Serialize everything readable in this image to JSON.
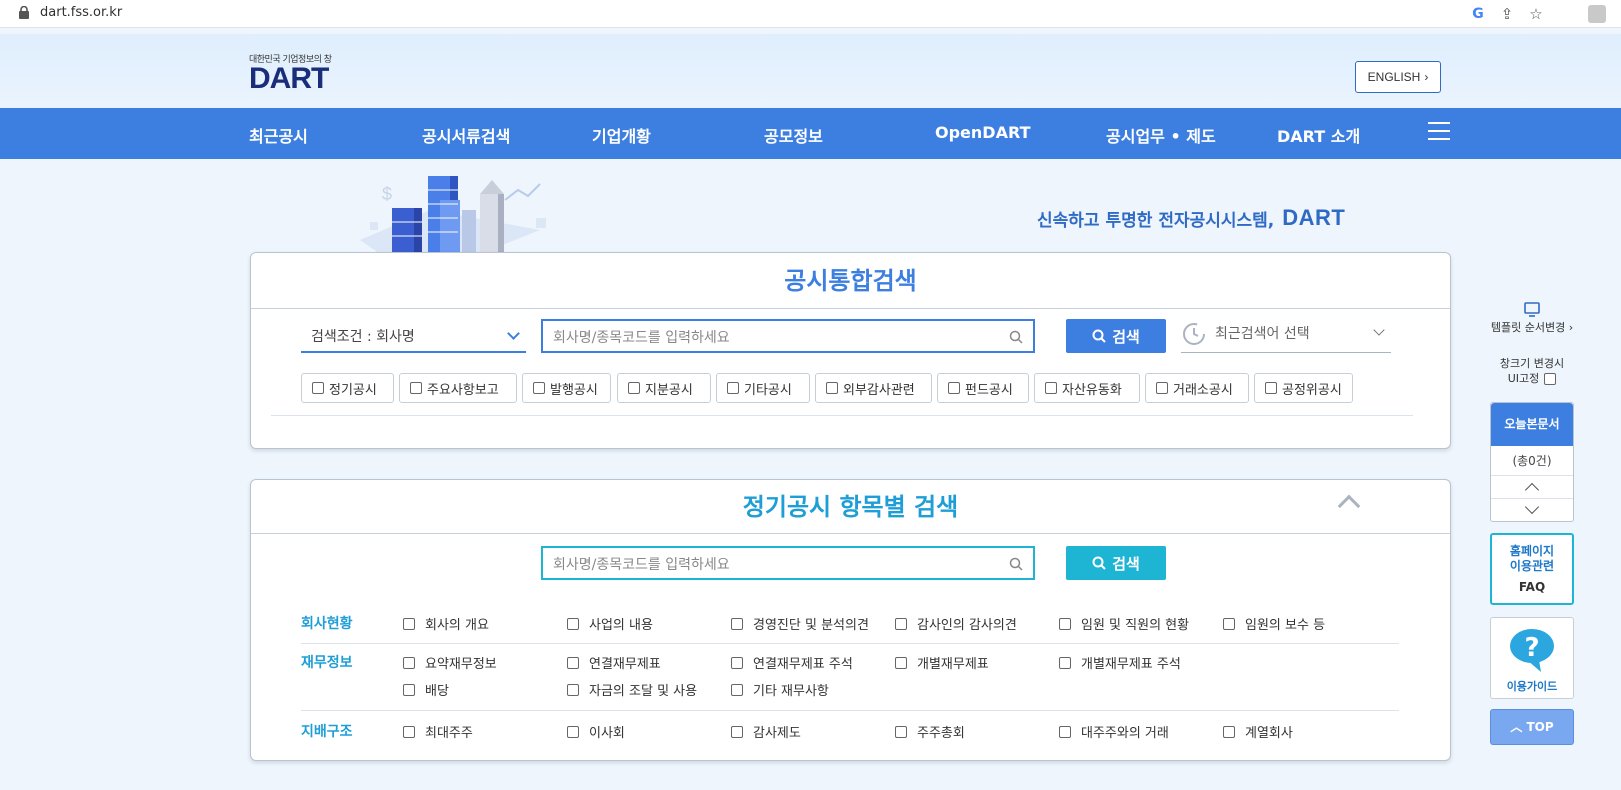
{
  "browser": {
    "url": "dart.fss.or.kr"
  },
  "header": {
    "logo_sub": "대한민국 기업정보의 창",
    "logo_main": "DART",
    "lang_button": "ENGLISH"
  },
  "nav": {
    "items": [
      "최근공시",
      "공시서류검색",
      "기업개황",
      "공모정보",
      "OpenDART",
      "공시업무 • 제도",
      "DART 소개"
    ]
  },
  "hero": {
    "slogan": "신속하고 투명한 전자공시시스템,",
    "slogan_brand": "DART"
  },
  "search": {
    "title": "공시통합검색",
    "condition": "검색조건 : 회사명",
    "placeholder": "회사명/종목코드를 입력하세요",
    "button": "검색",
    "recent": "최근검색어 선택",
    "types": [
      "정기공시",
      "주요사항보고",
      "발행공시",
      "지분공시",
      "기타공시",
      "외부감사관련",
      "펀드공시",
      "자산유동화",
      "거래소공시",
      "공정위공시"
    ]
  },
  "regular": {
    "title": "정기공시 항목별 검색",
    "placeholder": "회사명/종목코드를 입력하세요",
    "button": "검색",
    "groups": [
      {
        "label": "회사현황",
        "options": [
          "회사의 개요",
          "사업의 내용",
          "경영진단 및 분석의견",
          "감사인의 감사의견",
          "임원 및 직원의 현황",
          "임원의 보수 등"
        ]
      },
      {
        "label": "재무정보",
        "options": [
          "요약재무정보",
          "연결재무제표",
          "연결재무제표 주석",
          "개별재무제표",
          "개별재무제표 주석",
          "배당",
          "자금의 조달 및 사용",
          "기타 재무사항"
        ]
      },
      {
        "label": "지배구조",
        "options": [
          "최대주주",
          "이사회",
          "감사제도",
          "주주총회",
          "대주주와의 거래",
          "계열회사"
        ]
      }
    ]
  },
  "sidebar": {
    "template": "템플릿 순서변경",
    "fix_line1": "창크기 변경시",
    "fix_line2": "UI고정",
    "today_title": "오늘본문서",
    "today_count": "(총0건)",
    "faq_line1": "홈페이지",
    "faq_line2": "이용관련",
    "faq_line3": "FAQ",
    "guide": "이용가이드",
    "top": "TOP"
  },
  "colors": {
    "primary": "#3d7fe1",
    "teal": "#1e9ed6",
    "navy": "#1a2d7a"
  }
}
